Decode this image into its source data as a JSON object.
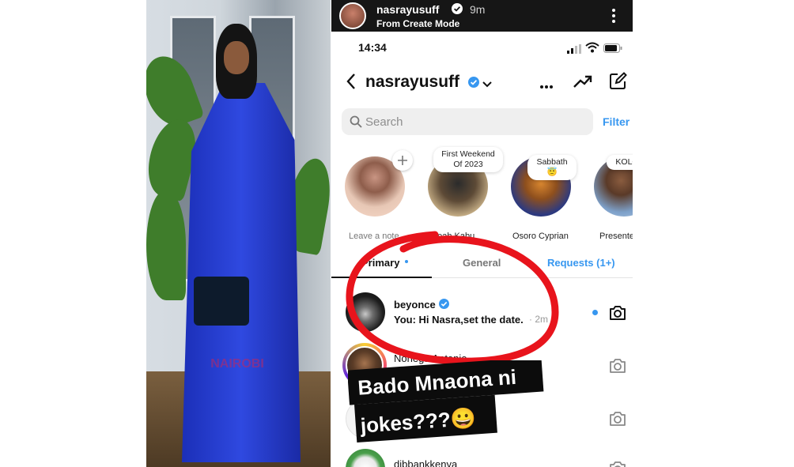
{
  "story_header": {
    "username": "nasrayusuff",
    "time": "9m",
    "subtitle": "From Create Mode"
  },
  "status_bar": {
    "time": "14:34"
  },
  "header": {
    "title": "nasrayusuff"
  },
  "search": {
    "placeholder": "Search",
    "filter_label": "Filter"
  },
  "notes": [
    {
      "name": "Leave a note",
      "bubble": ""
    },
    {
      "name": "Leah Kabu",
      "bubble": "First Weekend Of 2023"
    },
    {
      "name": "Osoro Cyprian",
      "bubble": "Sabbath😇"
    },
    {
      "name": "Presente",
      "bubble": "KOLO"
    }
  ],
  "tabs": [
    {
      "label": "Primary"
    },
    {
      "label": "General"
    },
    {
      "label": "Requests (1+)"
    }
  ],
  "messages": [
    {
      "name": "beyonce",
      "preview": "You: Hi Nasra,set the date.",
      "time": "· 2m"
    },
    {
      "name": "Noriega Antonio",
      "preview": "",
      "time": ""
    },
    {
      "name": "",
      "preview": "",
      "time": ""
    },
    {
      "name": "dibbankkenya",
      "preview": "",
      "time": ""
    }
  ],
  "sticker": {
    "line1": "Bado Mnaona ni",
    "line2": "jokes???😀"
  },
  "photo_watermark": "NAIROBI",
  "colors": {
    "accent_blue": "#3797f0",
    "circle_red": "#e8141c",
    "robe_blue": "#2f49e0"
  }
}
